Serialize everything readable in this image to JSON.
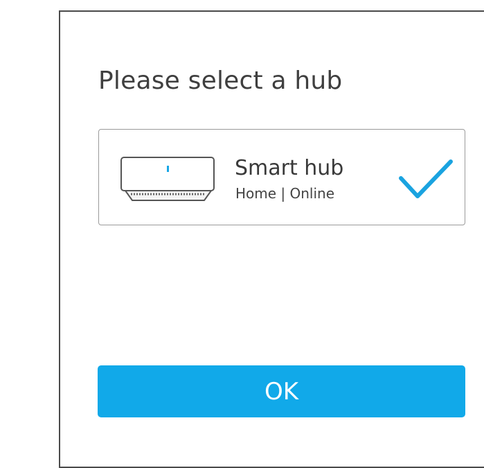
{
  "dialog": {
    "title": "Please select a hub",
    "hubs": [
      {
        "name": "Smart hub",
        "status": "Home | Online",
        "selected": true,
        "icon": "hub-device-icon"
      }
    ],
    "ok_label": "OK"
  },
  "colors": {
    "accent": "#11a9e9",
    "check": "#1aa3e0",
    "text": "#3f3f3f",
    "border": "#9a9a9a"
  }
}
